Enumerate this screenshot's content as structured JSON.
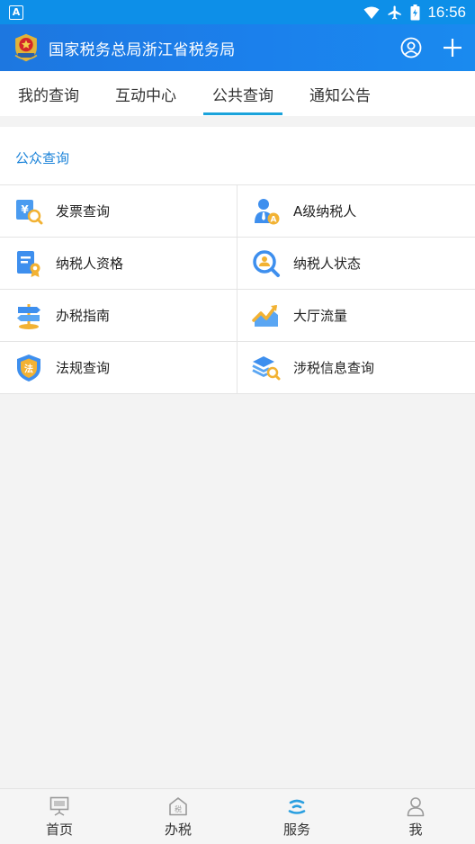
{
  "status_bar": {
    "notification_icon": "A",
    "time": "16:56"
  },
  "header": {
    "title": "国家税务总局浙江省税务局"
  },
  "tabs": [
    {
      "label": "我的查询",
      "active": false
    },
    {
      "label": "互动中心",
      "active": false
    },
    {
      "label": "公共查询",
      "active": true
    },
    {
      "label": "通知公告",
      "active": false
    }
  ],
  "section": {
    "title": "公众查询",
    "items": [
      {
        "label": "发票查询",
        "icon": "invoice-search-icon"
      },
      {
        "label": "A级纳税人",
        "icon": "a-level-taxpayer-icon"
      },
      {
        "label": "纳税人资格",
        "icon": "taxpayer-qualification-icon"
      },
      {
        "label": "纳税人状态",
        "icon": "taxpayer-status-icon"
      },
      {
        "label": "办税指南",
        "icon": "signpost-icon"
      },
      {
        "label": "大厅流量",
        "icon": "trend-chart-icon"
      },
      {
        "label": "法规查询",
        "icon": "law-shield-icon"
      },
      {
        "label": "涉税信息查询",
        "icon": "layers-search-icon"
      }
    ]
  },
  "bottom_nav": [
    {
      "label": "首页",
      "icon": "home-icon",
      "active": false
    },
    {
      "label": "办税",
      "icon": "tax-house-icon",
      "active": false
    },
    {
      "label": "服务",
      "icon": "service-icon",
      "active": true
    },
    {
      "label": "我",
      "icon": "person-icon",
      "active": false
    }
  ],
  "colors": {
    "accent": "#1b83d9",
    "header_blue": "#1b7fe9",
    "tab_indicator": "#1aa3db"
  }
}
